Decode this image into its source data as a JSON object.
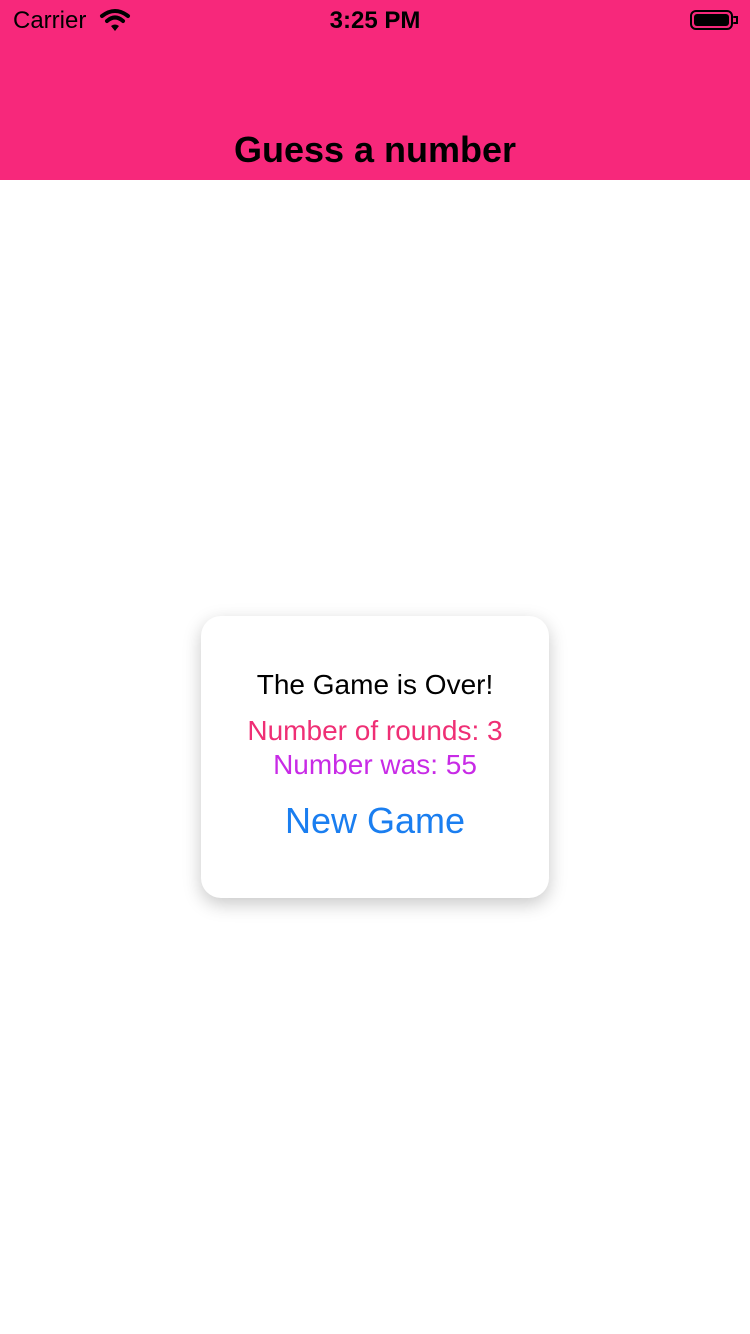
{
  "status_bar": {
    "carrier": "Carrier",
    "time": "3:25 PM",
    "icons": [
      "wifi-icon",
      "battery-icon"
    ]
  },
  "header": {
    "title": "Guess a number",
    "background_color": "#f7287b"
  },
  "dialog": {
    "heading": "The Game is Over!",
    "rounds_text": "Number of rounds: 3",
    "number_text": "Number was: 55",
    "button_label": "New Game",
    "colors": {
      "rounds": "#ef2f75",
      "number": "#c82be6",
      "button": "#1a7ef0"
    }
  }
}
